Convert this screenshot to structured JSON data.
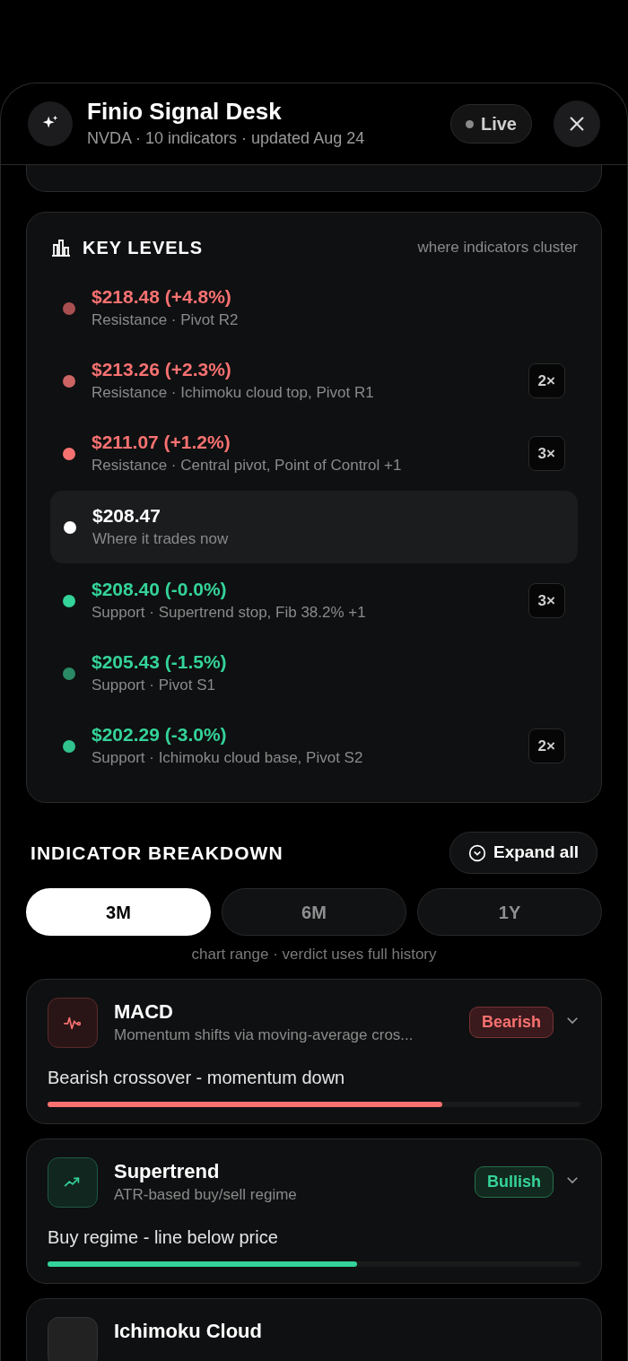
{
  "header": {
    "title": "Finio Signal Desk",
    "subtitle": "NVDA · 10 indicators · updated Aug 24",
    "status": {
      "label": "Live",
      "on": false
    }
  },
  "key_levels": {
    "title": "KEY LEVELS",
    "hint": "where indicators cluster",
    "levels": [
      {
        "kind": "resistance",
        "price": "$218.48 (+4.8%)",
        "detail": "Resistance · Pivot R2",
        "color": "#a84f52"
      },
      {
        "kind": "resistance",
        "price": "$213.26 (+2.3%)",
        "detail": "Resistance · Ichimoku cloud top, Pivot R1",
        "color": "#cc6464",
        "count": "2×"
      },
      {
        "kind": "resistance",
        "price": "$211.07 (+1.2%)",
        "detail": "Resistance · Central pivot, Point of Control +1",
        "color": "#f87171",
        "count": "3×"
      },
      {
        "kind": "current",
        "price": "$208.47",
        "detail": "Where it trades now",
        "color": "#ffffff"
      },
      {
        "kind": "support",
        "price": "$208.40 (-0.0%)",
        "detail": "Support · Supertrend stop, Fib 38.2% +1",
        "color": "#34d399",
        "count": "3×"
      },
      {
        "kind": "support",
        "price": "$205.43 (-1.5%)",
        "detail": "Support · Pivot S1",
        "color": "#2a8a65"
      },
      {
        "kind": "support",
        "price": "$202.29 (-3.0%)",
        "detail": "Support · Ichimoku cloud base, Pivot S2",
        "color": "#31c28d",
        "count": "2×"
      }
    ]
  },
  "breakdown": {
    "title": "INDICATOR BREAKDOWN",
    "expand_button": "Expand all",
    "ranges": [
      {
        "label": "3M",
        "selected": true
      },
      {
        "label": "6M",
        "selected": false
      },
      {
        "label": "1Y",
        "selected": false
      }
    ],
    "caption": "chart range · verdict uses full history",
    "indicators": [
      {
        "name": "MACD",
        "description": "Momentum shifts via moving-average cros...",
        "verdict": "Bearish",
        "kind": "bearish",
        "signal": "Bearish crossover - momentum down",
        "level": 0.74
      },
      {
        "name": "Supertrend",
        "description": "ATR-based buy/sell regime",
        "verdict": "Bullish",
        "kind": "bullish",
        "signal": "Buy regime - line below price",
        "level": 0.58
      },
      {
        "name": "Ichimoku Cloud",
        "kind": "neutral"
      }
    ]
  }
}
